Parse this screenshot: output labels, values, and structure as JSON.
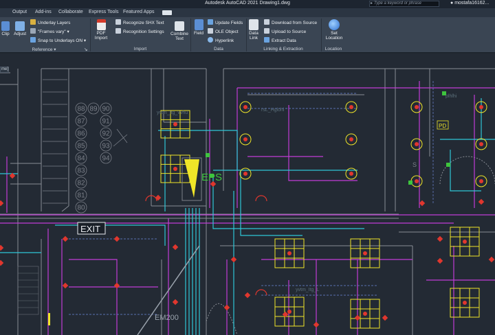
{
  "window": {
    "title": "Autodesk AutoCAD 2021   Drawing1.dwg"
  },
  "search": {
    "placeholder": "Type a keyword or phrase"
  },
  "user": {
    "name": "mostafa16162..."
  },
  "tabs": [
    "Output",
    "Add-ins",
    "Collaborate",
    "Express Tools",
    "Featured Apps"
  ],
  "ribbon": {
    "reference": {
      "clip": "Clip",
      "adjust": "Adjust",
      "underlay_layers": "Underlay Layers",
      "frames_vary": "\"Frames vary\"",
      "snap_to_underlays": "Snap to Underlays ON",
      "label": "Reference"
    },
    "import": {
      "pdf_import": "PDF Import",
      "recognize_shx": "Recognize SHX Text",
      "recognition_settings": "Recognition Settings",
      "combine_text": "Combine Text",
      "label": "Import"
    },
    "data": {
      "field": "Field",
      "update_fields": "Update Fields",
      "ole_object": "OLE Object",
      "hyperlink": "Hyperlink",
      "label": "Data"
    },
    "linking": {
      "data_link": "Data Link",
      "download_from_source": "Download from Source",
      "upload_to_source": "Upload to Source",
      "extract_data": "Extract  Data",
      "label": "Linking & Extraction"
    },
    "location": {
      "set_location": "Set Location",
      "label": "Location"
    }
  },
  "canvas": {
    "view_label": "me]",
    "lift_numbers": [
      "88",
      "89",
      "90",
      "87",
      "91",
      "86",
      "92",
      "85",
      "93",
      "84",
      "94",
      "83",
      "82",
      "81",
      "80"
    ],
    "labels": {
      "eps": "EPS",
      "exit": "EXIT",
      "pd": "PD",
      "em200": "EM200",
      "room_a": "yvtm_Itg_vvhu",
      "room_b": "rsL_Hglohi",
      "room_c": "plhlhi",
      "room_d": "yvtm_Itg_L",
      "s_mark": "S"
    }
  },
  "colors": {
    "titlebar": "#1d2530",
    "ribbon": "#3a4553",
    "canvas": "#232a34",
    "wall": "#8a8e96",
    "magenta": "#c23cd6",
    "cyan": "#2ec7d8",
    "yellow": "#f0e628",
    "red": "#e0372e",
    "green": "#3ec43e",
    "blue": "#6e88d8"
  }
}
